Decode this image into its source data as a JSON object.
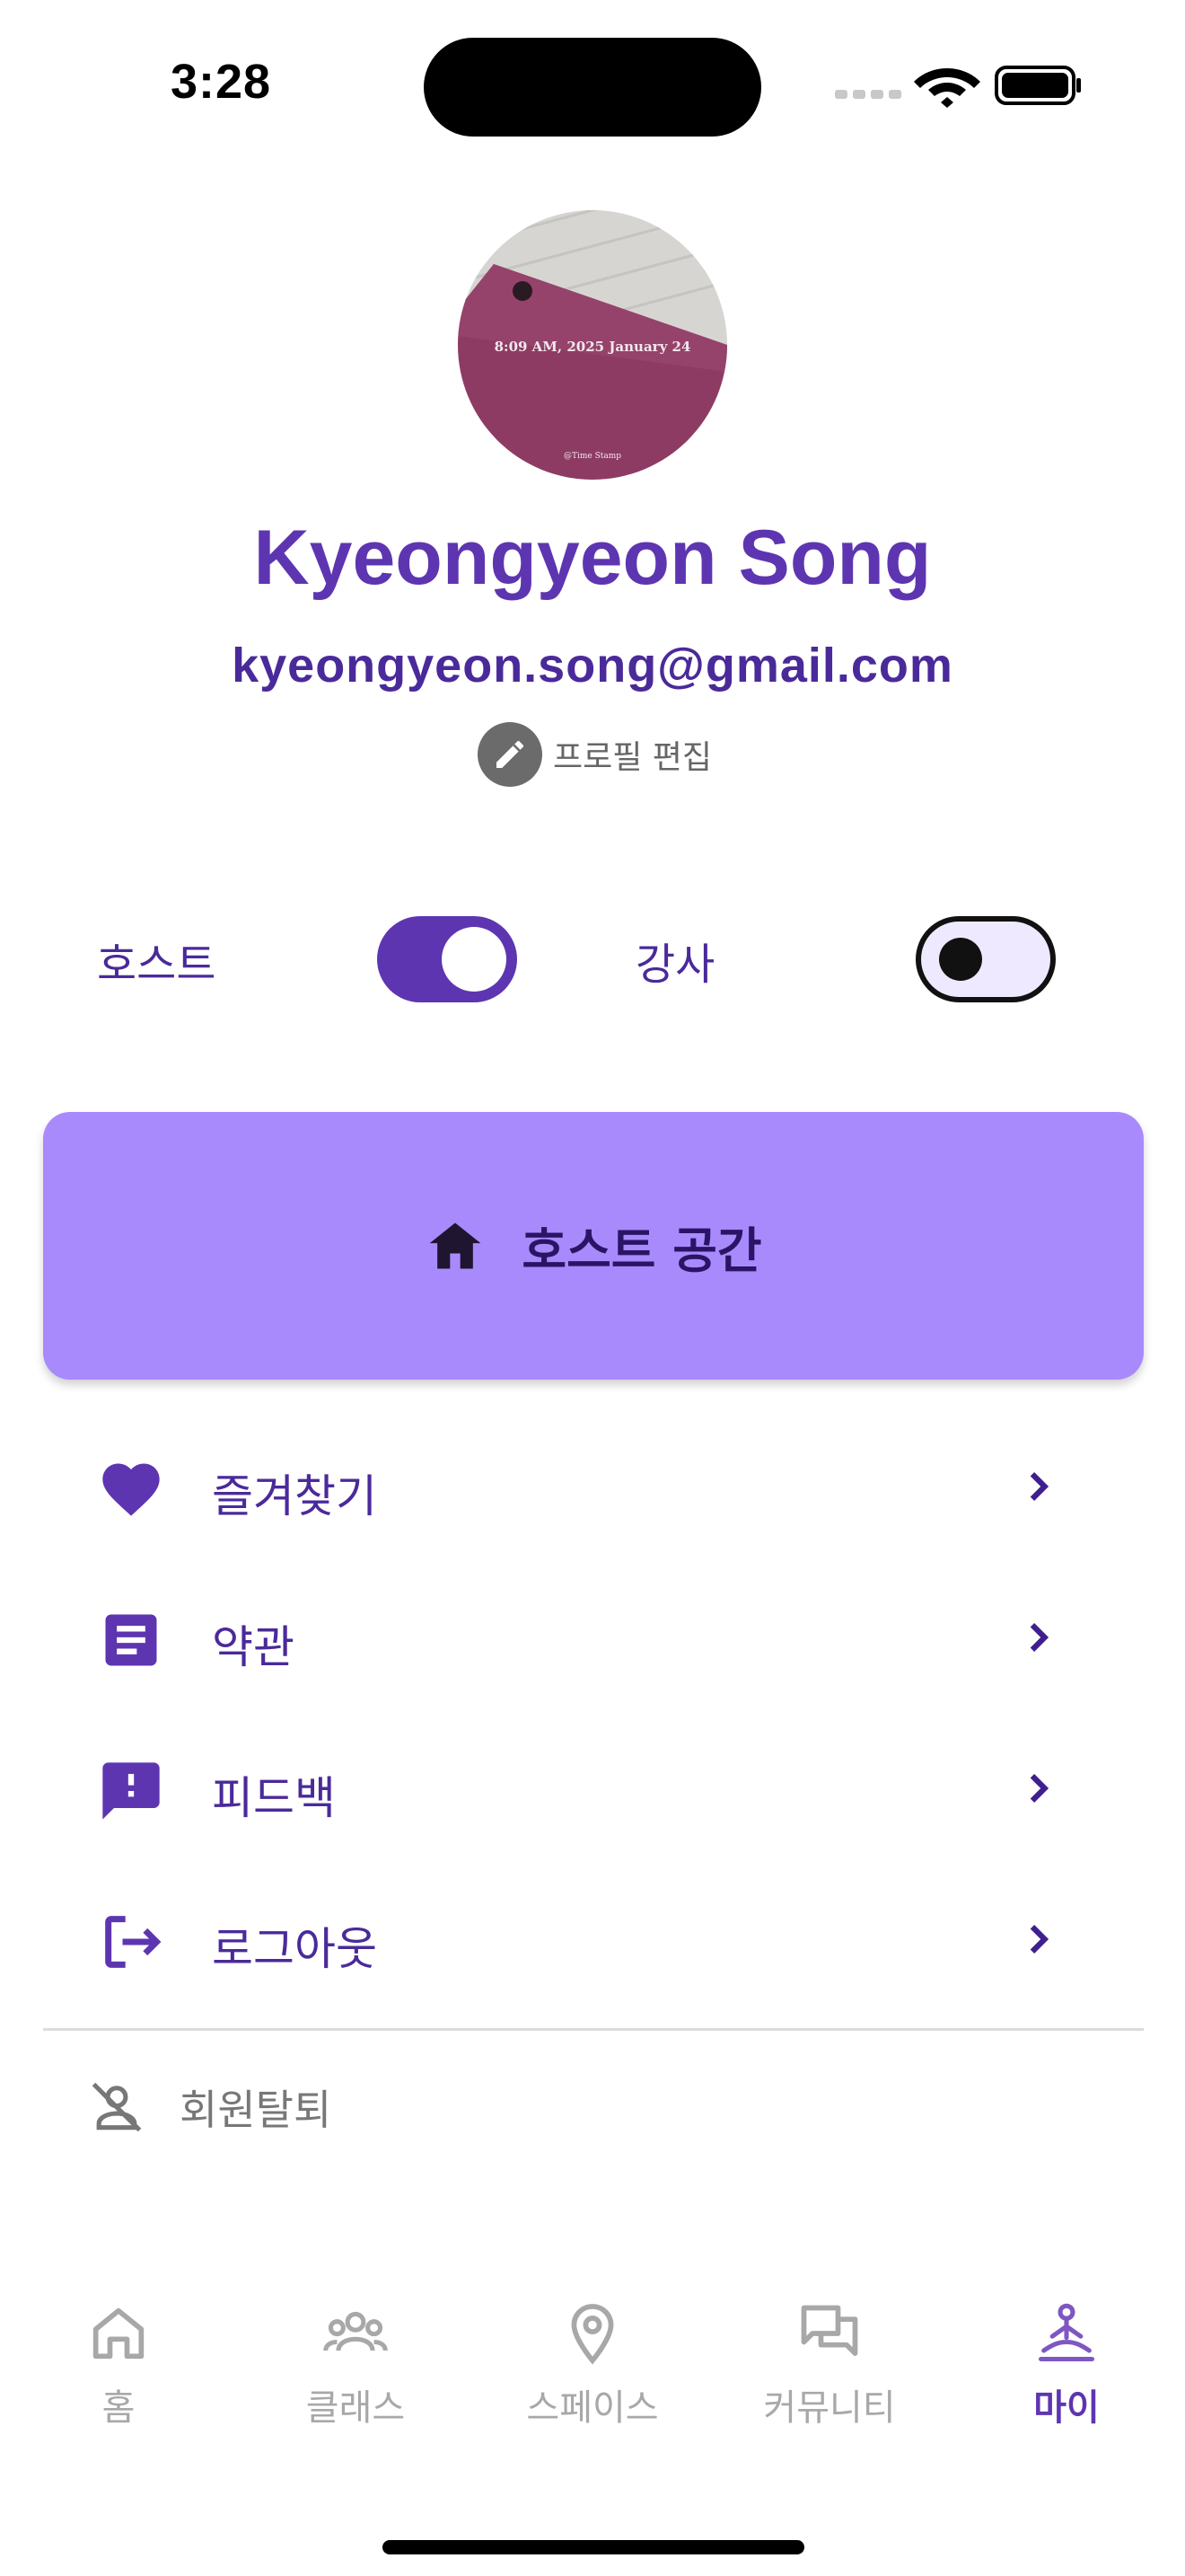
{
  "status_bar": {
    "time": "3:28"
  },
  "profile": {
    "avatar_stamp": "8:09 AM, 2025 January 24",
    "avatar_stamp_small": "@Time Stamp",
    "name": "Kyeongyeon Song",
    "email": "kyeongyeon.song@gmail.com",
    "edit_label": "프로필 편집"
  },
  "roles": {
    "host": {
      "label": "호스트",
      "on": true
    },
    "instructor": {
      "label": "강사",
      "on": false
    }
  },
  "host_space_button": {
    "label": "호스트 공간",
    "icon": "home-icon"
  },
  "menu": [
    {
      "label": "즐겨찾기",
      "icon": "heart-icon"
    },
    {
      "label": "약관",
      "icon": "document-icon"
    },
    {
      "label": "피드백",
      "icon": "feedback-icon"
    },
    {
      "label": "로그아웃",
      "icon": "logout-icon"
    }
  ],
  "withdraw": {
    "label": "회원탈퇴",
    "icon": "person-off-icon"
  },
  "bottom_nav": [
    {
      "label": "홈",
      "icon": "home-outline-icon",
      "active": false
    },
    {
      "label": "클래스",
      "icon": "group-icon",
      "active": false
    },
    {
      "label": "스페이스",
      "icon": "location-pin-icon",
      "active": false
    },
    {
      "label": "커뮤니티",
      "icon": "forum-icon",
      "active": false
    },
    {
      "label": "마이",
      "icon": "meditation-icon",
      "active": true
    }
  ],
  "colors": {
    "primary": "#5e35b1",
    "primary_dark": "#4a2a9a",
    "host_button_bg": "#a98afc",
    "inactive": "#a8a8a8"
  }
}
